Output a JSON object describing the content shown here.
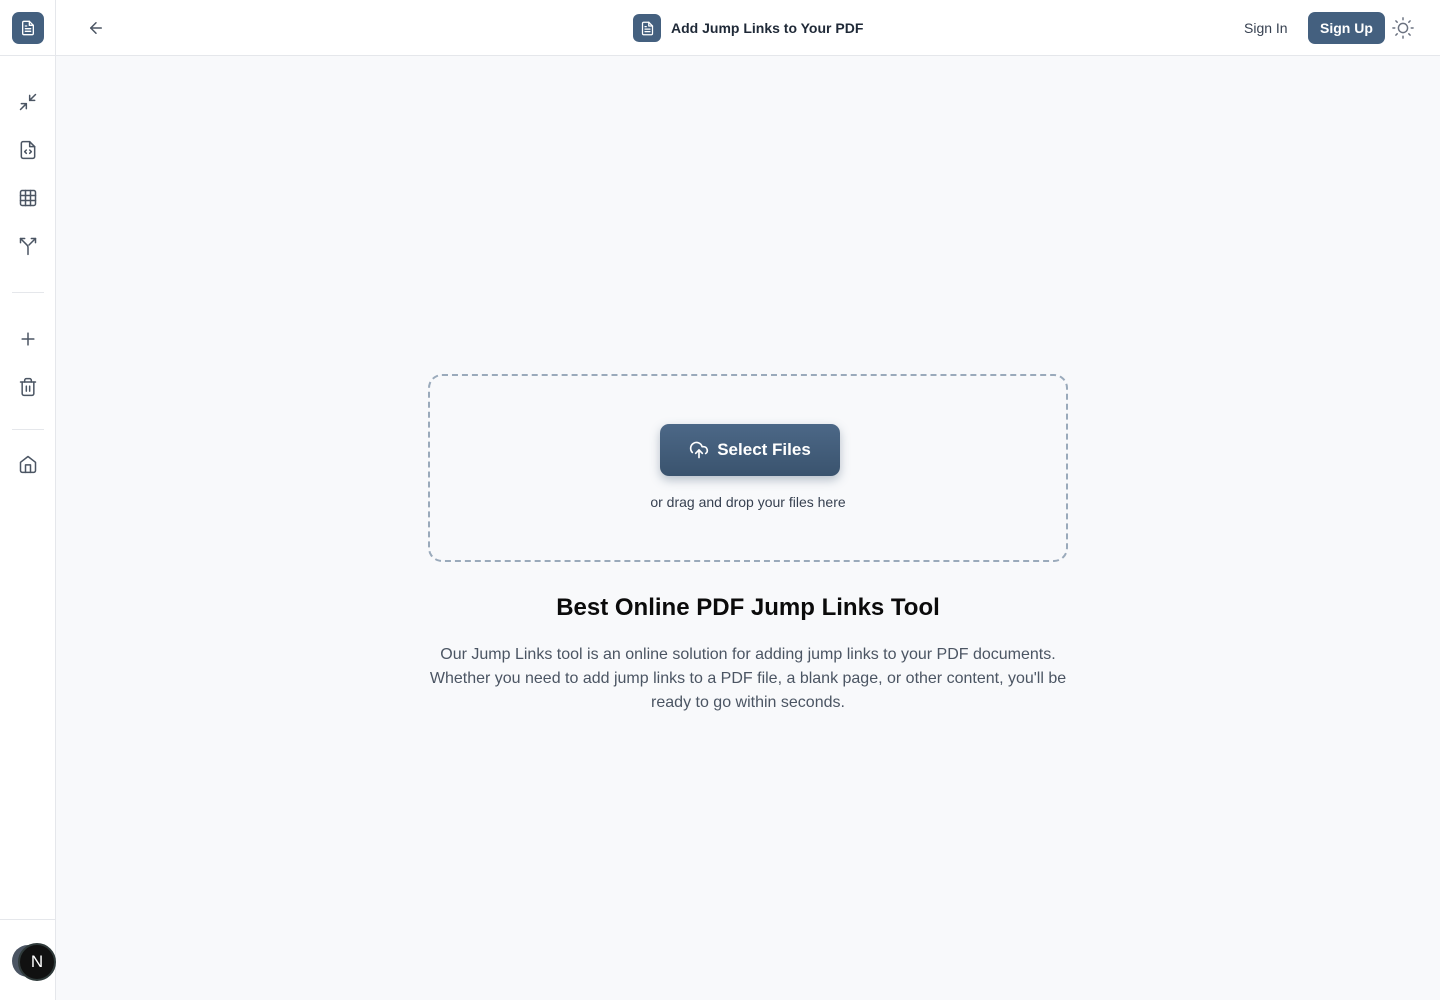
{
  "header": {
    "title": "Add Jump Links to Your PDF",
    "sign_in": "Sign In",
    "sign_up": "Sign Up"
  },
  "sidebar": {
    "avatar_initial": "N",
    "items": [
      {
        "name": "compress",
        "icon": "minimize-arrows-icon"
      },
      {
        "name": "pdf-to-code",
        "icon": "file-code-icon"
      },
      {
        "name": "table",
        "icon": "table-grid-icon"
      },
      {
        "name": "split",
        "icon": "split-arrows-icon"
      },
      {
        "name": "add",
        "icon": "plus-icon"
      },
      {
        "name": "delete",
        "icon": "trash-icon"
      },
      {
        "name": "home",
        "icon": "home-icon"
      }
    ]
  },
  "main": {
    "select_files": "Select Files",
    "drop_hint": "or drag and drop your files here",
    "headline": "Best Online PDF Jump Links Tool",
    "description": "Our Jump Links tool is an online solution for adding jump links to your PDF documents. Whether you need to add jump links to a PDF file, a blank page, or other content, you'll be ready to go within seconds."
  },
  "colors": {
    "accent": "#44607f",
    "background": "#f8f9fb",
    "border": "#e5e7eb"
  }
}
